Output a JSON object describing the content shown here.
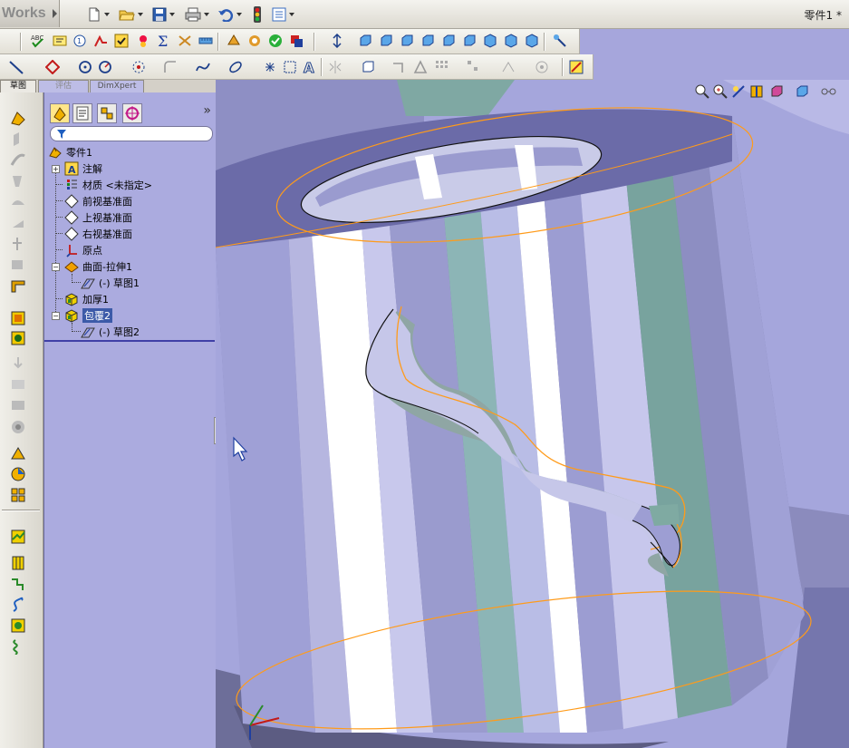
{
  "app": {
    "brand": "Works",
    "document_title": "零件1 *"
  },
  "colors": {
    "viewport_bg": "#a5a6dc",
    "panel_bg": "#ababdf",
    "model_edge": "#ff9b1a",
    "selection": "#3c5aa8"
  },
  "toolbar_icons": [
    "new-document-icon",
    "open-folder-icon",
    "save-icon",
    "print-icon",
    "undo-icon",
    "rebuild-traffic-light-icon",
    "options-icon"
  ],
  "tabs": [
    {
      "label": "草图"
    },
    {
      "label": "评估"
    },
    {
      "label": "DimXpert"
    }
  ],
  "panel": {
    "tab_icons": [
      "feature-manager-icon",
      "property-manager-icon",
      "configuration-manager-icon",
      "dim-xpert-manager-icon"
    ],
    "expand_symbol": "»"
  },
  "tree": {
    "root": "零件1",
    "items": [
      {
        "label": "注解",
        "icon": "annotations-icon",
        "expandable": true
      },
      {
        "label": "材质 <未指定>",
        "icon": "material-icon",
        "expandable": false
      },
      {
        "label": "前视基准面",
        "icon": "plane-icon",
        "expandable": false
      },
      {
        "label": "上视基准面",
        "icon": "plane-icon",
        "expandable": false
      },
      {
        "label": "右视基准面",
        "icon": "plane-icon",
        "expandable": false
      },
      {
        "label": "原点",
        "icon": "origin-icon",
        "expandable": false
      },
      {
        "label": "曲面-拉伸1",
        "icon": "surface-extrude-icon",
        "expandable": true,
        "expanded": true
      },
      {
        "label": "(-) 草图1",
        "icon": "sketch-icon",
        "child": true
      },
      {
        "label": "加厚1",
        "icon": "thicken-icon",
        "expandable": false
      },
      {
        "label": "包覆2",
        "icon": "wrap-icon",
        "expandable": true,
        "expanded": true,
        "selected": true
      },
      {
        "label": "(-) 草图2",
        "icon": "sketch-icon",
        "child": true
      }
    ]
  }
}
